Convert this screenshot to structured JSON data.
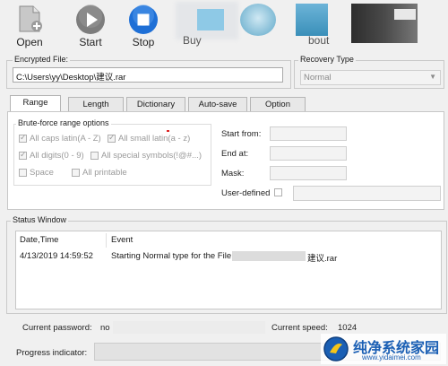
{
  "toolbar": {
    "open_label": "Open",
    "start_label": "Start",
    "stop_label": "Stop",
    "partial_label_1": "Buy",
    "partial_label_2": "bout"
  },
  "encrypted_file": {
    "label": "Encrypted File:",
    "value": "C:\\Users\\yy\\Desktop\\建议.rar"
  },
  "recovery_type": {
    "label": "Recovery Type",
    "selected": "Normal"
  },
  "tabs": [
    {
      "label": "Range",
      "active": true
    },
    {
      "label": "Length",
      "active": false
    },
    {
      "label": "Dictionary",
      "active": false
    },
    {
      "label": "Auto-save",
      "active": false
    },
    {
      "label": "Option",
      "active": false
    }
  ],
  "range": {
    "group_label": "Brute-force range options",
    "options": [
      {
        "label": "All caps latin(A - Z)",
        "checked": true
      },
      {
        "label": "All small latin(a - z)",
        "checked": true
      },
      {
        "label": "All digits(0 - 9)",
        "checked": true
      },
      {
        "label": "All special symbols(!@#...)",
        "checked": false
      },
      {
        "label": "Space",
        "checked": false
      },
      {
        "label": "All printable",
        "checked": false
      }
    ],
    "start_from_label": "Start from:",
    "end_at_label": "End at:",
    "mask_label": "Mask:",
    "user_defined_label": "User-defined"
  },
  "status_window": {
    "label": "Status Window",
    "columns": [
      "Date,Time",
      "Event"
    ],
    "rows": [
      {
        "datetime": "4/13/2019 14:59:52",
        "event_prefix": "Starting Normal type for the File:",
        "event_suffix": "建议.rar"
      }
    ]
  },
  "footer": {
    "current_password_label": "Current password:",
    "current_password_value": "no",
    "current_speed_label": "Current speed:",
    "current_speed_value": "1024",
    "progress_label": "Progress indicator:"
  },
  "watermark": {
    "title": "纯净系统家园",
    "url": "www.yidaimei.com"
  },
  "colors": {
    "stop_blue": "#1e6fd6",
    "start_grey": "#7d7d7d",
    "watermark_blue": "#1a5fb4"
  }
}
